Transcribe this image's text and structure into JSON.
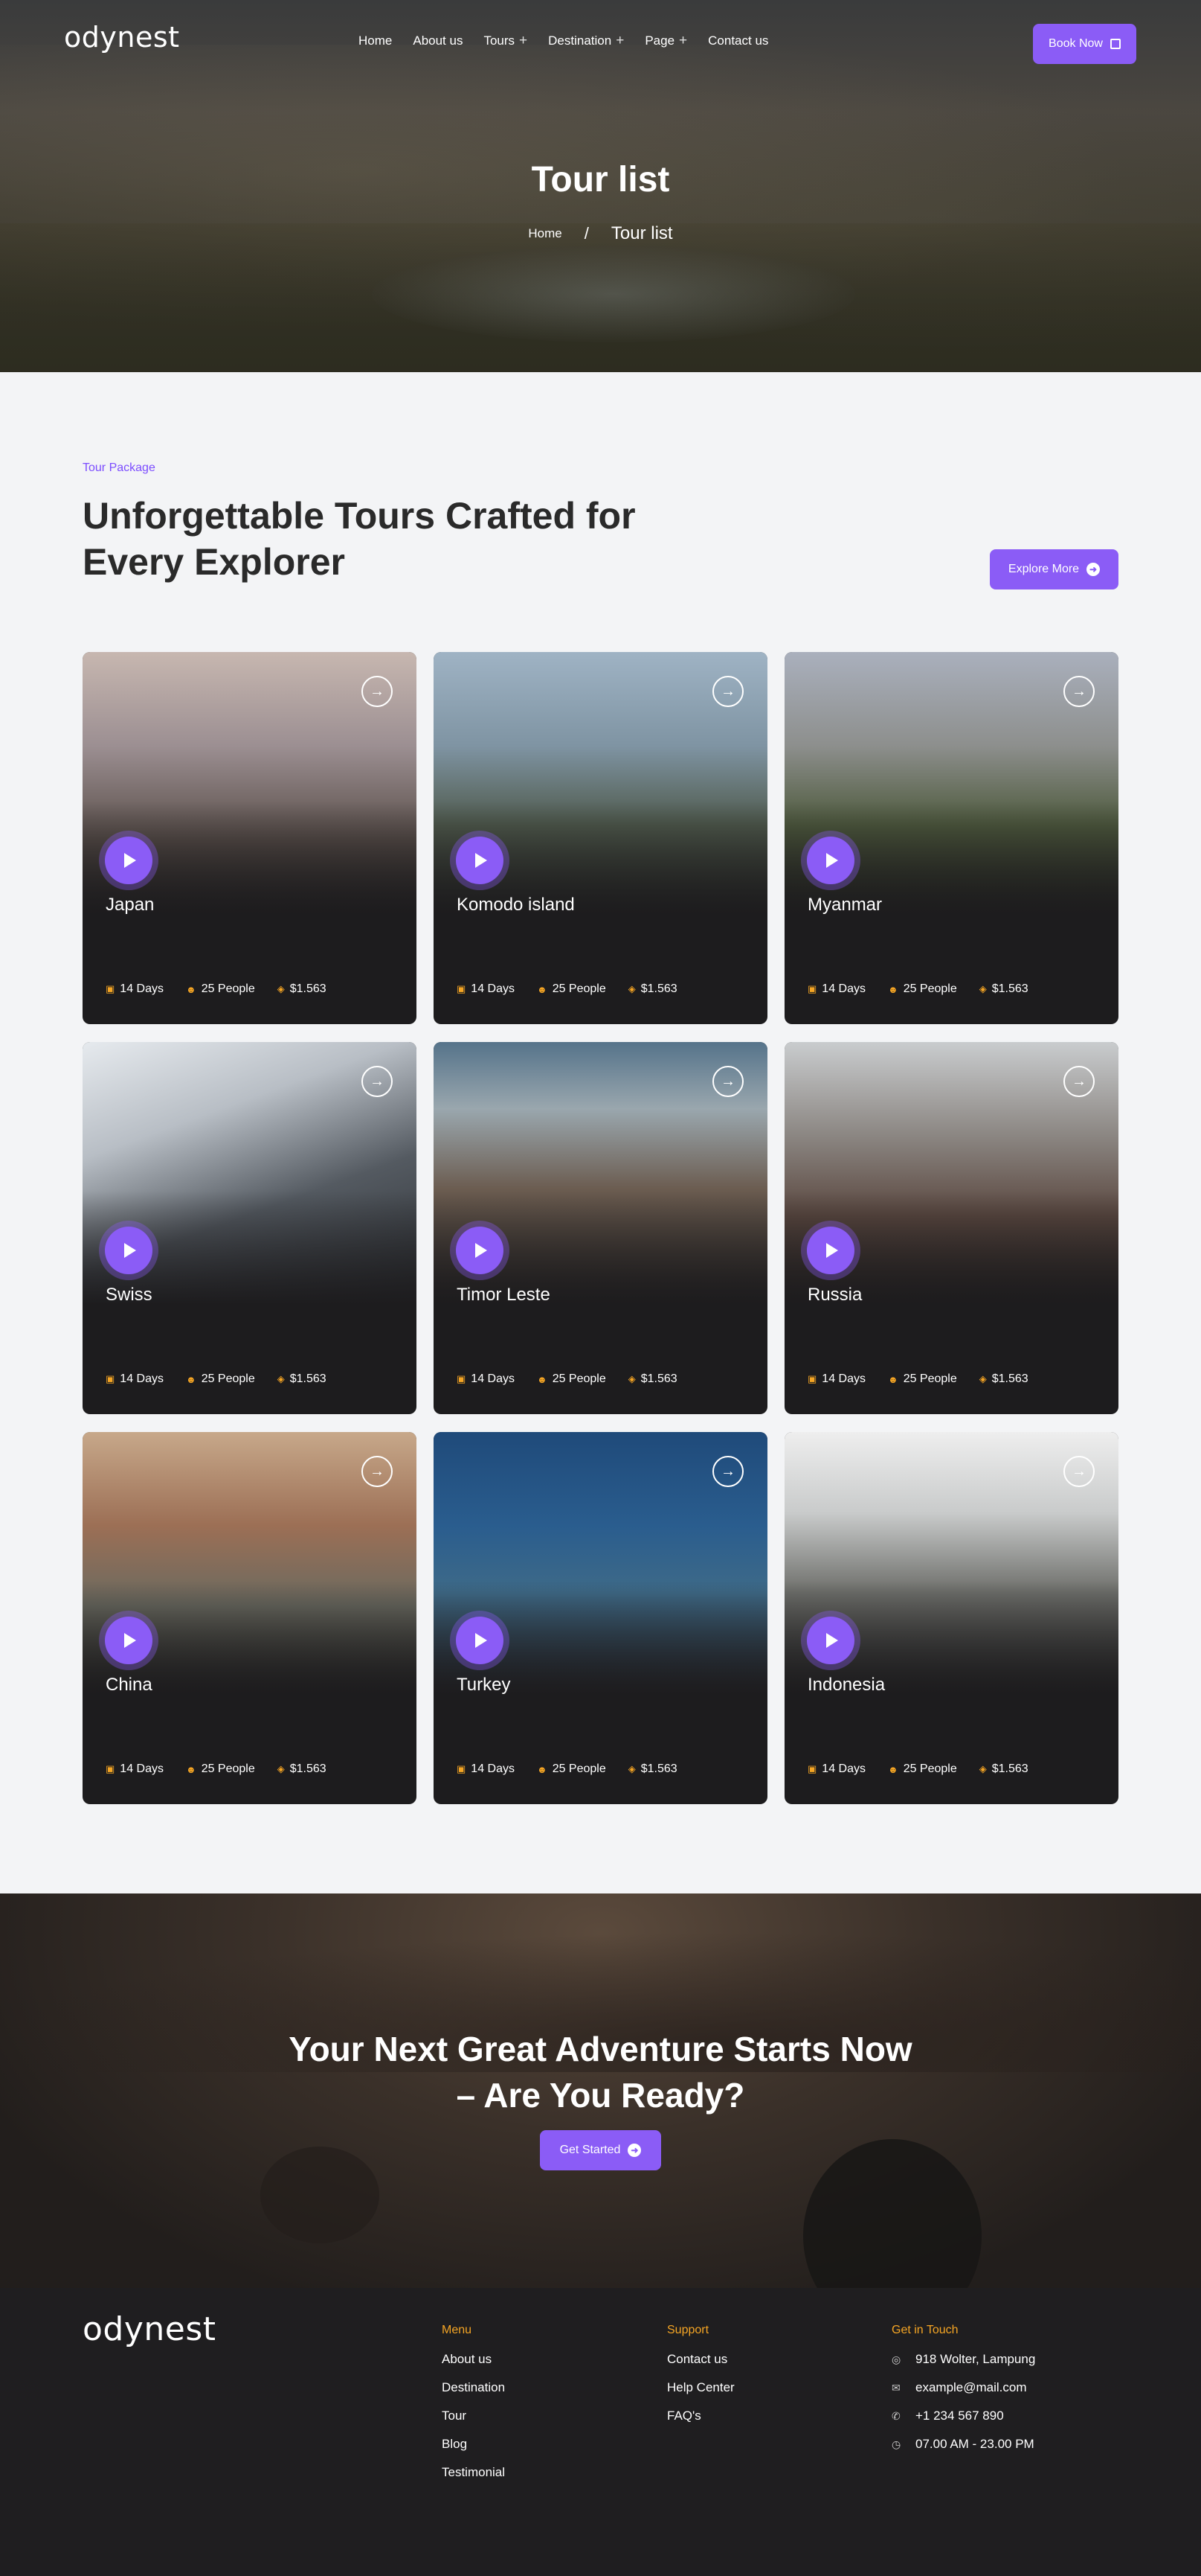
{
  "brand": {
    "logo": "odynest"
  },
  "nav": {
    "items": [
      {
        "label": "Home",
        "has_dropdown": false
      },
      {
        "label": "About us",
        "has_dropdown": false
      },
      {
        "label": "Tours",
        "has_dropdown": true
      },
      {
        "label": "Destination",
        "has_dropdown": true
      },
      {
        "label": "Page",
        "has_dropdown": true
      },
      {
        "label": "Contact us",
        "has_dropdown": false
      }
    ],
    "book_button": "Book Now"
  },
  "hero": {
    "title": "Tour list",
    "breadcrumb": {
      "home": "Home",
      "separator": "/",
      "current": "Tour list"
    }
  },
  "section": {
    "eyebrow": "Tour Package",
    "title": "Unforgettable Tours Crafted for Every Explorer",
    "explore_button": "Explore More"
  },
  "tours": [
    {
      "name": "Japan",
      "days": "14 Days",
      "people": "25 People",
      "price": "$1.563"
    },
    {
      "name": "Komodo island",
      "days": "14 Days",
      "people": "25 People",
      "price": "$1.563"
    },
    {
      "name": "Myanmar",
      "days": "14 Days",
      "people": "25 People",
      "price": "$1.563"
    },
    {
      "name": "Swiss",
      "days": "14 Days",
      "people": "25 People",
      "price": "$1.563"
    },
    {
      "name": "Timor Leste",
      "days": "14 Days",
      "people": "25 People",
      "price": "$1.563"
    },
    {
      "name": "Russia",
      "days": "14 Days",
      "people": "25 People",
      "price": "$1.563"
    },
    {
      "name": "China",
      "days": "14 Days",
      "people": "25 People",
      "price": "$1.563"
    },
    {
      "name": "Turkey",
      "days": "14 Days",
      "people": "25 People",
      "price": "$1.563"
    },
    {
      "name": "Indonesia",
      "days": "14 Days",
      "people": "25 People",
      "price": "$1.563"
    }
  ],
  "cta": {
    "title_line1": "Your Next Great Adventure Starts Now",
    "title_line2": "– Are You Ready?",
    "button": "Get Started"
  },
  "footer": {
    "logo": "odynest",
    "menu": {
      "heading": "Menu",
      "links": [
        "About us",
        "Destination",
        "Tour",
        "Blog",
        "Testimonial"
      ]
    },
    "support": {
      "heading": "Support",
      "links": [
        "Contact us",
        "Help Center",
        "FAQ's"
      ]
    },
    "contact": {
      "heading": "Get in Touch",
      "address": "918 Wolter, Lampung",
      "email": "example@mail.com",
      "phone": "+1 234 567 890",
      "hours": "07.00 AM - 23.00 PM"
    }
  },
  "colors": {
    "accent": "#8b5cf6",
    "highlight": "#f5a524",
    "card": "#1d1c1e",
    "text_dark": "#2a2a2a"
  }
}
